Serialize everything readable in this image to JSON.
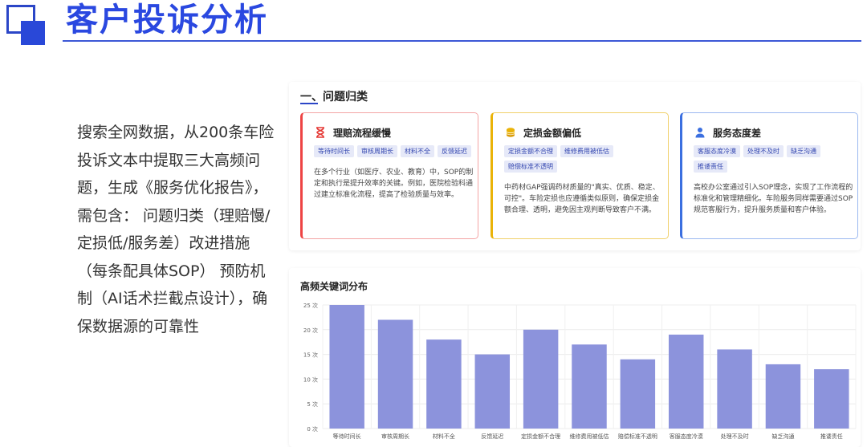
{
  "header": {
    "title": "客户投诉分析"
  },
  "description": "搜索全网数据，从200条车险投诉文本中提取三大高频问题，生成《服务优化报告》，需包含： 问题归类（理赔慢/定损低/服务差）改进措施（每条配具体SOP） 预防机制（AI话术拦截点设计），确保数据源的可靠性",
  "section": {
    "title": "一、问题归类"
  },
  "cards": [
    {
      "icon": "hourglass-icon",
      "glyph": "⌛",
      "color": "#e53935",
      "title": "理赔流程缓慢",
      "tags": [
        "等待时间长",
        "审核周期长",
        "材料不全",
        "反馈延迟"
      ],
      "text": "在多个行业（如医疗、农业、教育）中，SOP的制定和执行是提升效率的关键。例如，医院检验科通过建立标准化流程，提高了检验质量与效率。"
    },
    {
      "icon": "coins-icon",
      "glyph": "●",
      "color": "#eab308",
      "title": "定损金额偏低",
      "tags": [
        "定损金额不合理",
        "维修费用被低估",
        "赔偿标准不透明"
      ],
      "text": "中药材GAP强调药材质量的\"真实、优质、稳定、可控\"。车险定损也应遵循类似原则，确保定损金额合理、透明，避免因主观判断导致客户不满。"
    },
    {
      "icon": "user-icon",
      "glyph": "👤",
      "color": "#3b6fe0",
      "title": "服务态度差",
      "tags": [
        "客服态度冷漠",
        "处理不及时",
        "缺乏沟通",
        "推诿责任"
      ],
      "text": "高校办公室通过引入SOP理念，实现了工作流程的标准化和管理精细化。车险服务同样需要通过SOP规范客服行为，提升服务质量和客户体验。"
    }
  ],
  "chart_data": {
    "type": "bar",
    "title": "高频关键词分布",
    "categories": [
      "等待时间长",
      "审核周期长",
      "材料不全",
      "反馈延迟",
      "定损金额不合理",
      "维修费用被低估",
      "赔偿标准不透明",
      "客服态度冷漠",
      "处理不及时",
      "缺乏沟通",
      "推诿责任"
    ],
    "values": [
      25,
      22,
      18,
      15,
      20,
      17,
      14,
      19,
      16,
      13,
      12
    ],
    "ylim": [
      0,
      25
    ],
    "yticks": [
      "0 次",
      "5 次",
      "10 次",
      "15 次",
      "20 次",
      "25 次"
    ],
    "bar_color": "#8c93dc",
    "grid": true
  }
}
